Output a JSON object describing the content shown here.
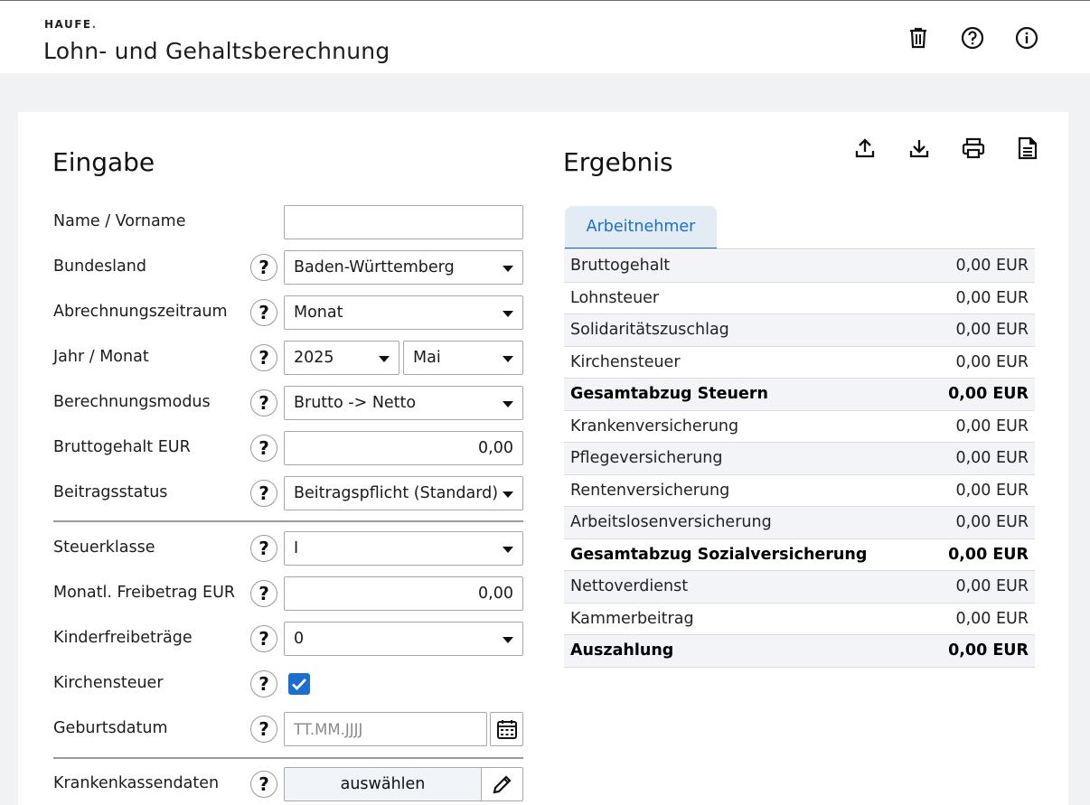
{
  "header": {
    "brand": "HAUFE",
    "brand_dot": ".",
    "title": "Lohn- und Gehaltsberechnung",
    "icons": [
      "trash-icon",
      "help-circle-icon",
      "info-circle-icon"
    ]
  },
  "input": {
    "heading": "Eingabe",
    "name_label": "Name / Vorname",
    "name_value": "",
    "bundesland_label": "Bundesland",
    "bundesland_value": "Baden-Württemberg",
    "zeitraum_label": "Abrechnungszeitraum",
    "zeitraum_value": "Monat",
    "jahr_label": "Jahr / Monat",
    "jahr_value": "2025",
    "monat_value": "Mai",
    "modus_label": "Berechnungsmodus",
    "modus_value": "Brutto -> Netto",
    "brutto_label": "Bruttogehalt EUR",
    "brutto_value": "0,00",
    "beitrag_label": "Beitragsstatus",
    "beitrag_value": "Beitragspflicht (Standard)",
    "steuerklasse_label": "Steuerklasse",
    "steuerklasse_value": "I",
    "freibetrag_label": "Monatl. Freibetrag EUR",
    "freibetrag_value": "0,00",
    "kinder_label": "Kinderfreibeträge",
    "kinder_value": "0",
    "kirche_label": "Kirchensteuer",
    "kirche_checked": true,
    "geburt_label": "Geburtsdatum",
    "geburt_placeholder": "TT.MM.JJJJ",
    "kk_label": "Krankenkassendaten",
    "kk_button": "auswählen",
    "help_glyph": "?"
  },
  "result": {
    "heading": "Ergebnis",
    "icons": [
      "upload-icon",
      "download-icon",
      "print-icon",
      "document-icon"
    ],
    "tab": "Arbeitnehmer",
    "rows": [
      {
        "label": "Bruttogehalt",
        "value": "0,00 EUR"
      },
      {
        "label": "Lohnsteuer",
        "value": "0,00 EUR"
      },
      {
        "label": "Solidaritätszuschlag",
        "value": "0,00 EUR"
      },
      {
        "label": "Kirchensteuer",
        "value": "0,00 EUR"
      },
      {
        "label": "Gesamtabzug Steuern",
        "value": "0,00 EUR",
        "bold": true
      },
      {
        "label": "Krankenversicherung",
        "value": "0,00 EUR"
      },
      {
        "label": "Pflegeversicherung",
        "value": "0,00 EUR"
      },
      {
        "label": "Rentenversicherung",
        "value": "0,00 EUR"
      },
      {
        "label": "Arbeitslosenversicherung",
        "value": "0,00 EUR"
      },
      {
        "label": "Gesamtabzug Sozialversicherung",
        "value": "0,00 EUR",
        "bold": true
      },
      {
        "label": "Nettoverdienst",
        "value": "0,00 EUR"
      },
      {
        "label": "Kammerbeitrag",
        "value": "0,00 EUR"
      },
      {
        "label": "Auszahlung",
        "value": "0,00 EUR",
        "bold": true
      }
    ]
  },
  "colors": {
    "accent": "#1b6fd1",
    "tab_bg": "#e3ebf5",
    "row_alt": "#f2f4f7"
  }
}
